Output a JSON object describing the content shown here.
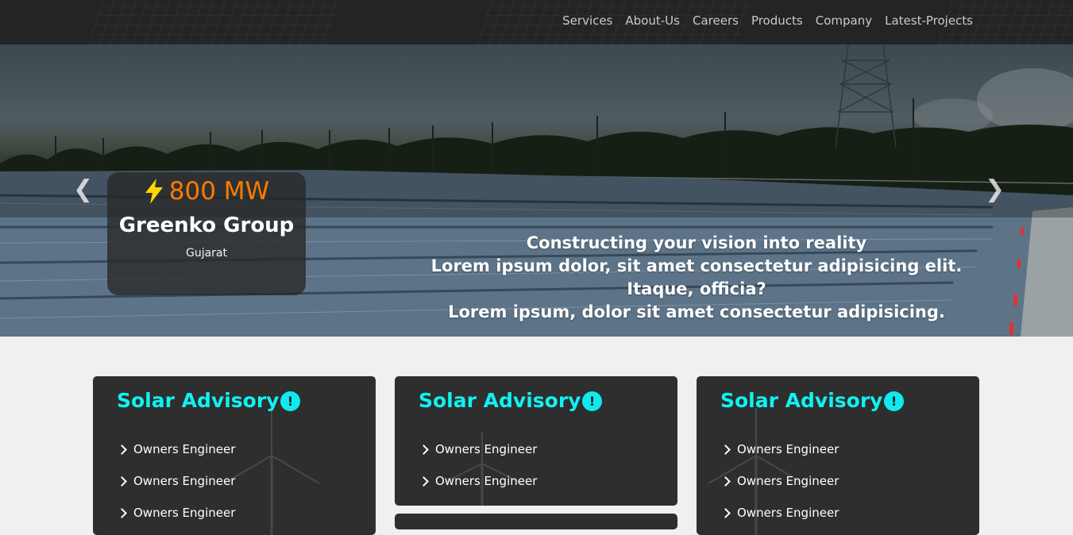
{
  "nav": {
    "links": [
      "Services",
      "About-Us",
      "Careers",
      "Products",
      "Company",
      "Latest-Projects"
    ]
  },
  "hero": {
    "project": {
      "capacity": "800 MW",
      "company": "Greenko Group",
      "location": "Gujarat"
    },
    "caption_lines": [
      "Constructing your vision into reality",
      "Lorem ipsum dolor, sit amet consectetur adipisicing elit.",
      "Itaque, officia?",
      "Lorem ipsum, dolor sit amet consectetur adipisicing."
    ],
    "prev_icon": "chevron-left-icon",
    "next_icon": "chevron-right-icon"
  },
  "cards": [
    {
      "title": "Solar Advisory",
      "items": [
        "Owners Engineer",
        "Owners Engineer",
        "Owners Engineer"
      ]
    },
    {
      "title": "Solar Advisory",
      "items": [
        "Owners Engineer",
        "Owners Engineer"
      ]
    },
    {
      "title": "Solar Advisory",
      "items": [
        "Owners Engineer",
        "Owners Engineer",
        "Owners Engineer"
      ]
    }
  ],
  "colors": {
    "accent_cyan": "#0ff2f2",
    "capacity_orange": "#ff7a00",
    "bolt_yellow": "#ffd800",
    "card_bg": "#2e2e2e",
    "nav_bg": "#232426"
  }
}
